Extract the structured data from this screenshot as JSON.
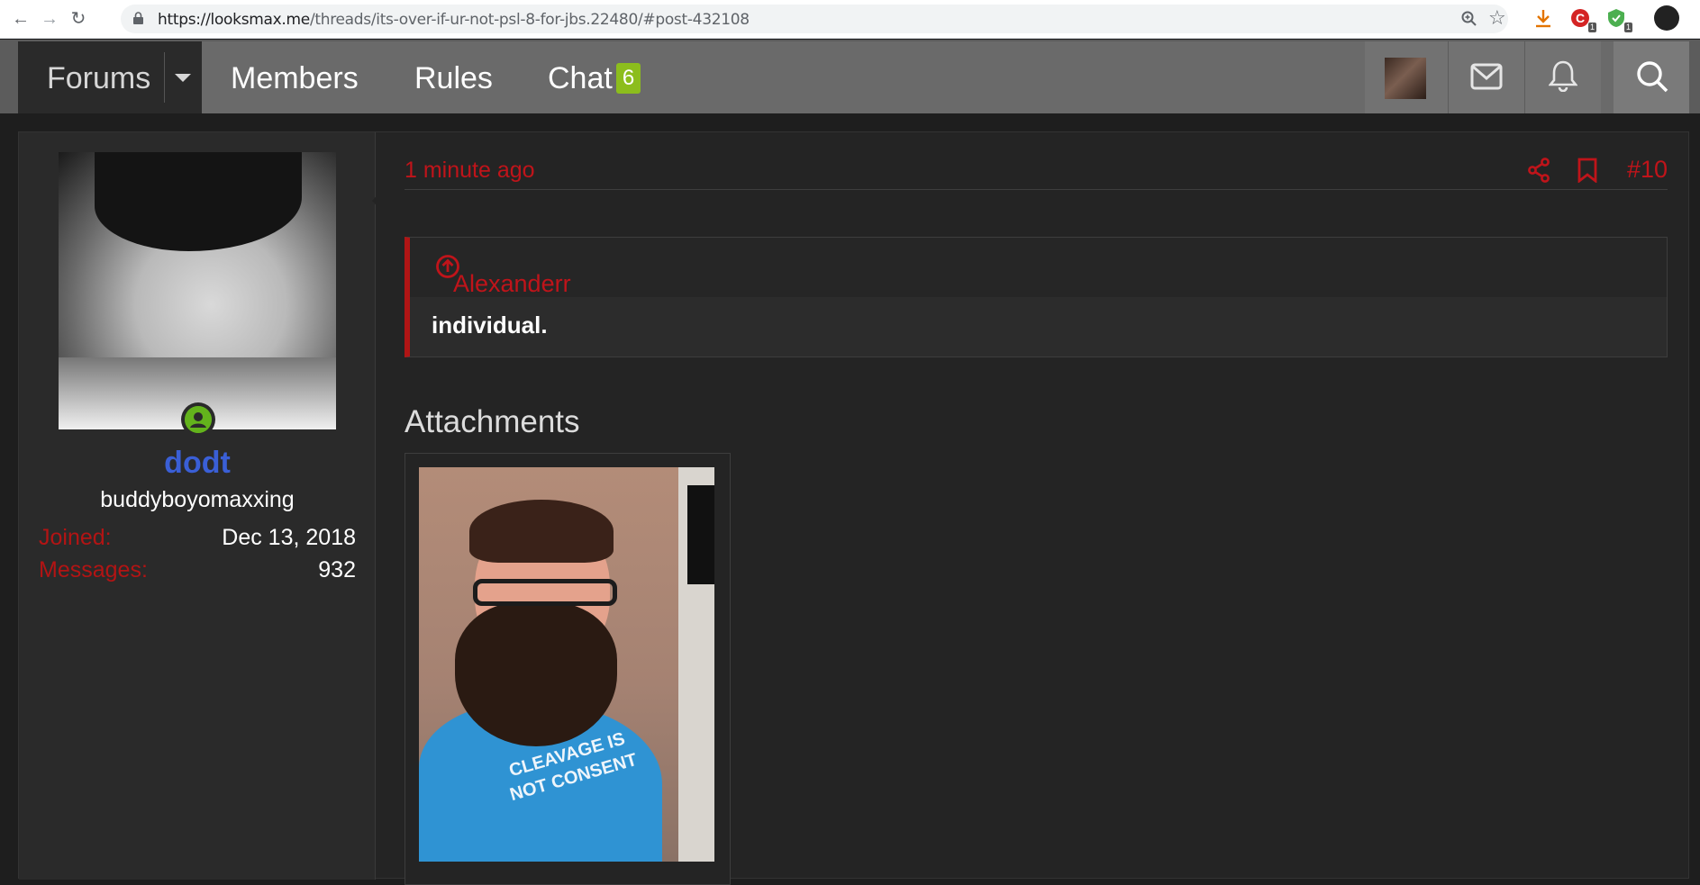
{
  "browser": {
    "url_host": "https://looksmax.me",
    "url_path": "/threads/its-over-if-ur-not-psl-8-for-jbs.22480/#post-432108",
    "ext_badges": [
      "1",
      "1"
    ]
  },
  "nav": {
    "forums": "Forums",
    "members": "Members",
    "rules": "Rules",
    "chat": "Chat",
    "chat_count": "6"
  },
  "user": {
    "name": "dodt",
    "title": "buddyboyomaxxing",
    "joined_label": "Joined:",
    "joined_value": "Dec 13, 2018",
    "messages_label": "Messages:",
    "messages_value": "932"
  },
  "post": {
    "time": "1 minute ago",
    "number": "#10",
    "quote_author": "Alexanderr said:",
    "quote_text": "individual.",
    "attachments_title": "Attachments",
    "shirt_text": "CLEAVAGE IS NOT CONSENT"
  },
  "colors": {
    "accent_red": "#c0141a",
    "username_blue": "#3a5fd6",
    "online_green": "#63b31c",
    "badge_green": "#8cbd1d"
  },
  "icons": [
    "back-icon",
    "forward-icon",
    "reload-icon",
    "lock-icon",
    "zoom-icon",
    "star-icon",
    "download-icon",
    "share-icon",
    "bookmark-icon",
    "envelope-icon",
    "bell-icon",
    "search-icon",
    "arrow-up-circle-icon",
    "user-online-icon"
  ]
}
